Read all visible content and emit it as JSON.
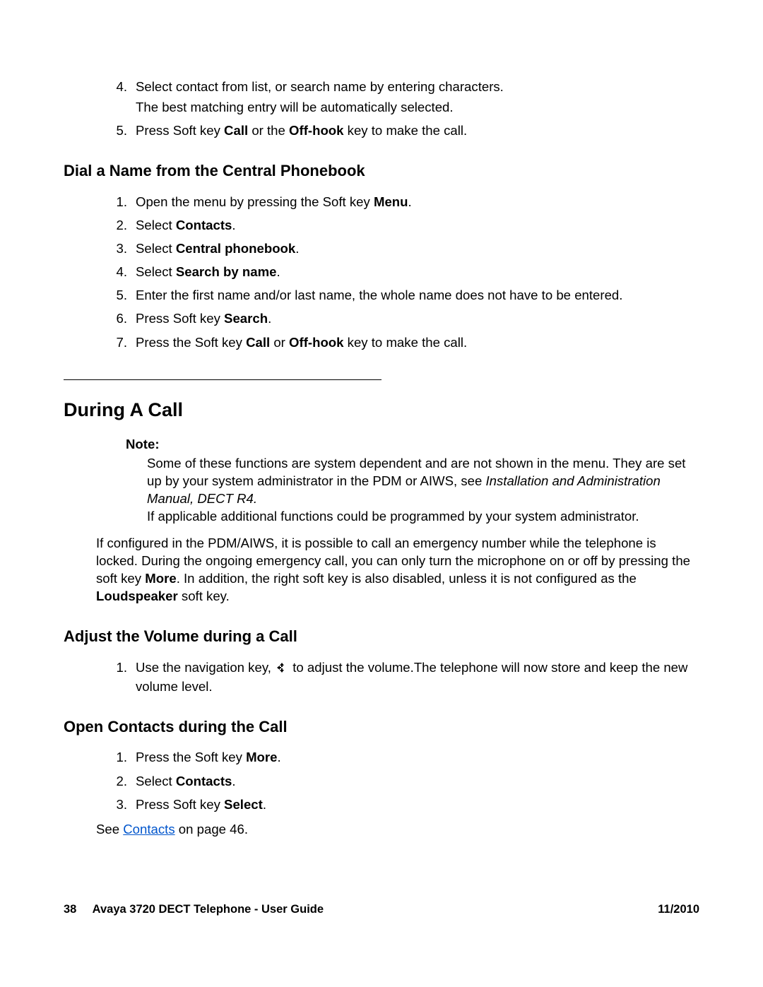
{
  "topList": {
    "items": [
      {
        "num": "4.",
        "text": "Select contact from list, or search name by entering characters.",
        "sub": "The best matching entry will be automatically selected."
      },
      {
        "num": "5.",
        "html": "Press Soft key <span class='b'>Call</span> or the <span class='b'>Off-hook</span> key to make the call."
      }
    ]
  },
  "h2a": "Dial a Name from the Central Phonebook",
  "listA": [
    {
      "num": "1.",
      "html": "Open the menu by pressing the Soft key <span class='b'>Menu</span>."
    },
    {
      "num": "2.",
      "html": "Select <span class='b'>Contacts</span>."
    },
    {
      "num": "3.",
      "html": "Select <span class='b'>Central phonebook</span>."
    },
    {
      "num": "4.",
      "html": "Select <span class='b'>Search by name</span>."
    },
    {
      "num": "5.",
      "html": "Enter the first name and/or last name, the whole name does not have to be entered."
    },
    {
      "num": "6.",
      "html": "Press Soft key <span class='b'>Search</span>."
    },
    {
      "num": "7.",
      "html": "Press the Soft key <span class='b'>Call</span> or <span class='b'>Off-hook</span> key to make the call."
    }
  ],
  "h1": "During A Call",
  "note": {
    "label": "Note:",
    "line1": "Some of these functions are system dependent and are not shown in the menu. They are set up by your system administrator in the PDM or AIWS, see ",
    "italic": "Installation and Administration Manual, DECT R4.",
    "line2": "If applicable additional functions could be programmed by your system administrator."
  },
  "para1": "If configured in the PDM/AIWS, it is possible to call an emergency number while the telephone is locked. During the ongoing emergency call, you can only turn the microphone on or off by pressing the soft key <span class='b'>More</span>. In addition, the right soft key is also disabled, unless it is not configured as the <span class='b'>Loudspeaker</span> soft key.",
  "h2b": "Adjust the Volume during a Call",
  "listB": [
    {
      "num": "1.",
      "html": "Use the navigation key, {NAV_ICON} to adjust the volume.The telephone will now store and keep the new volume level."
    }
  ],
  "h2c": "Open Contacts during the Call",
  "listC": [
    {
      "num": "1.",
      "html": "Press the Soft key <span class='b'>More</span>."
    },
    {
      "num": "2.",
      "html": "Select <span class='b'>Contacts</span>."
    },
    {
      "num": "3.",
      "html": "Press Soft key <span class='b'>Select</span>."
    }
  ],
  "see": {
    "pre": "See ",
    "link": "Contacts",
    "post": " on page 46."
  },
  "footer": {
    "pageNum": "38",
    "title": "Avaya 3720 DECT Telephone - User Guide",
    "date": "11/2010"
  }
}
